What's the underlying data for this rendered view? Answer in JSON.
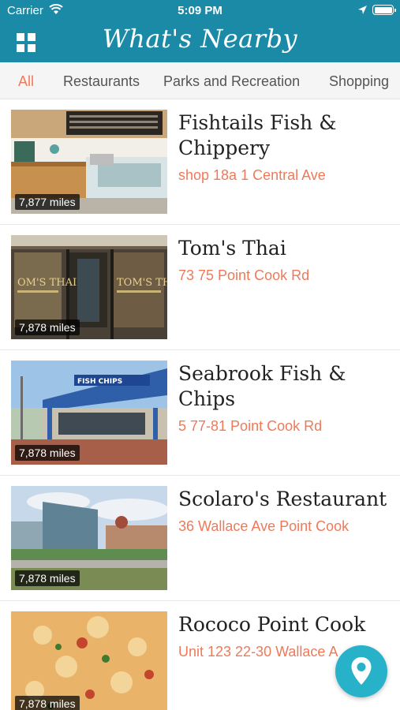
{
  "status_bar": {
    "carrier": "Carrier",
    "time": "5:09 PM"
  },
  "header": {
    "title": "What's Nearby",
    "menu_icon": "grid-menu-icon",
    "bg_color": "#1b8aa6"
  },
  "tabs": [
    {
      "label": "All",
      "active": true
    },
    {
      "label": "Restaurants"
    },
    {
      "label": "Parks and Recreation"
    },
    {
      "label": "Shopping"
    }
  ],
  "accent_color": "#ee7a5a",
  "places": [
    {
      "name": "Fishtails Fish & Chippery",
      "address": "shop 18a 1 Central Ave",
      "distance": "7,877 miles"
    },
    {
      "name": "Tom's Thai",
      "address": "73 75 Point Cook Rd",
      "distance": "7,878 miles"
    },
    {
      "name": "Seabrook Fish & Chips",
      "address": "5 77-81 Point Cook Rd",
      "distance": "7,878 miles"
    },
    {
      "name": "Scolaro's Restaurant",
      "address": "36 Wallace Ave Point Cook",
      "distance": "7,878 miles"
    },
    {
      "name": "Rococo Point Cook",
      "address": "Unit 123 22-30 Wallace A",
      "distance": "7,878 miles"
    }
  ],
  "map_button": {
    "icon": "map-pin-icon",
    "color": "#27b2c9"
  }
}
